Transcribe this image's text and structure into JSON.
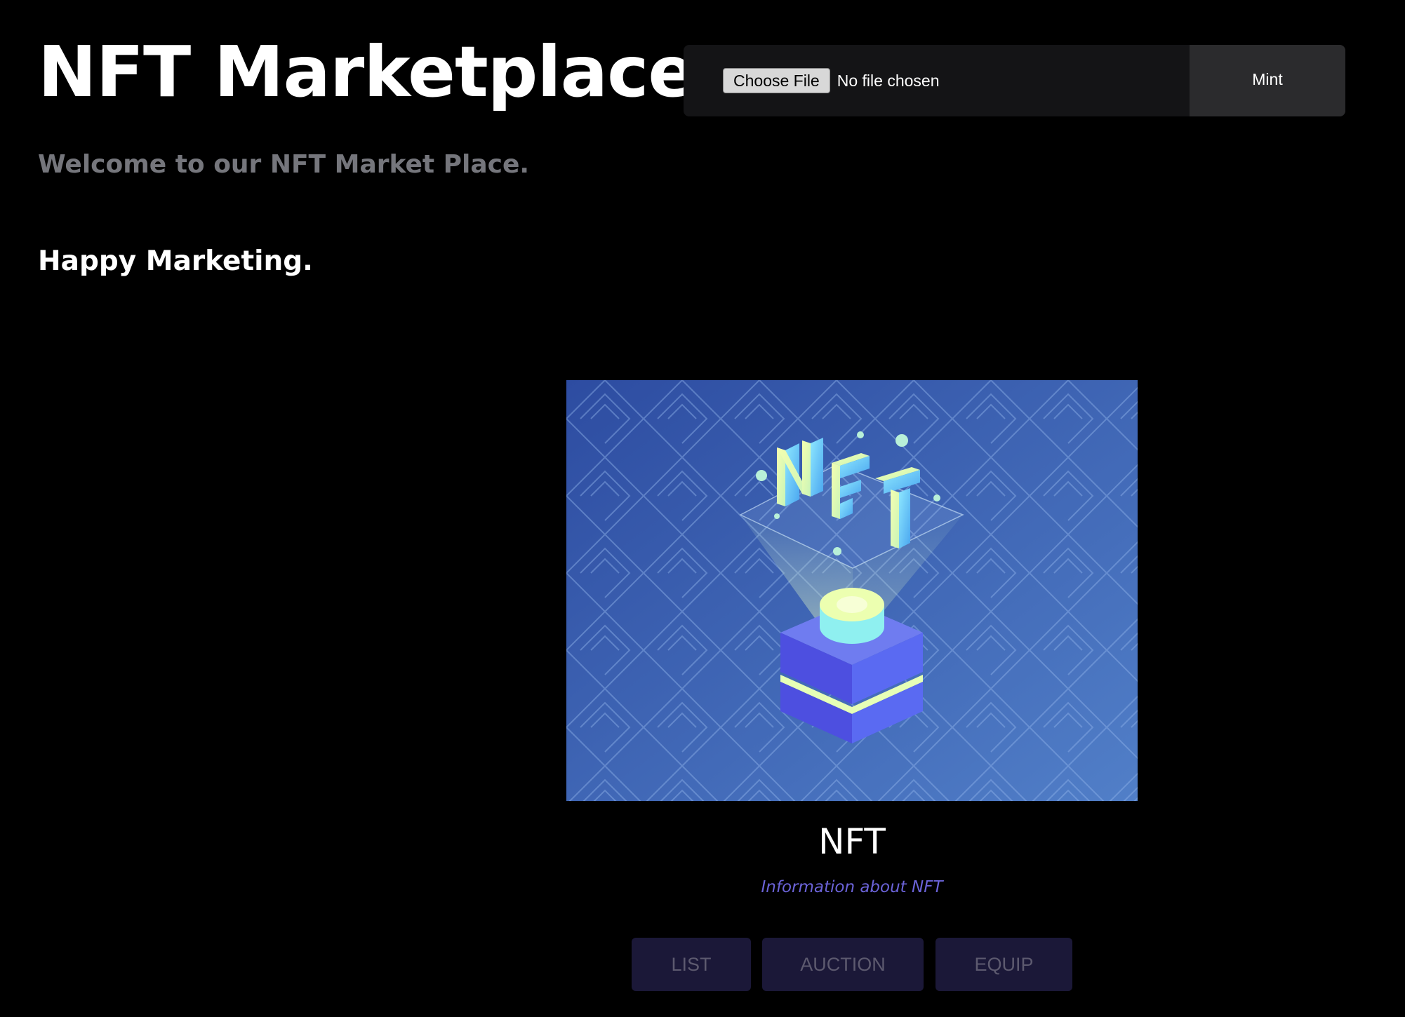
{
  "header": {
    "title": "NFT Marketplace",
    "subtitle": "Welcome to our NFT Market Place.",
    "tagline": "Happy Marketing."
  },
  "mint_form": {
    "choose_file_label": "Choose File",
    "file_status": "No file chosen",
    "mint_label": "Mint"
  },
  "nft_card": {
    "name": "NFT",
    "info": "Information about NFT",
    "image_text": "NFT",
    "actions": [
      "LIST",
      "AUCTION",
      "EQUIP"
    ]
  },
  "colors": {
    "background": "#000000",
    "subtitle": "#75767c",
    "info_text": "#6b63d8",
    "action_button_bg": "#1b1838",
    "action_button_text": "#5d5a6f",
    "image_bg_start": "#2f4fa3",
    "image_bg_end": "#4f7cc6"
  }
}
